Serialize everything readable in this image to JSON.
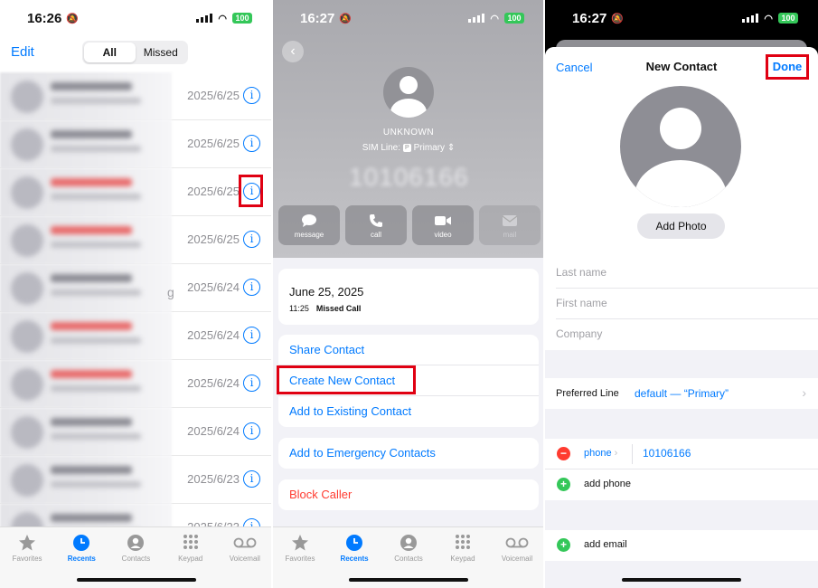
{
  "panel1": {
    "status_time": "16:26",
    "battery": "100",
    "edit_label": "Edit",
    "segment": [
      "All",
      "Missed"
    ],
    "calls": [
      {
        "date": "2025/6/25",
        "name_color": "gray"
      },
      {
        "date": "2025/6/25",
        "name_color": "gray"
      },
      {
        "date": "2025/6/25",
        "name_color": "red"
      },
      {
        "date": "2025/6/25",
        "name_color": "red"
      },
      {
        "date": "2025/6/24",
        "name_color": "gray"
      },
      {
        "date": "2025/6/24",
        "name_color": "red"
      },
      {
        "date": "2025/6/24",
        "name_color": "red"
      },
      {
        "date": "2025/6/24",
        "name_color": "gray"
      },
      {
        "date": "2025/6/23",
        "name_color": "gray"
      },
      {
        "date": "2025/6/23",
        "name_color": "gray"
      }
    ],
    "stray_char": "g",
    "tabs": [
      {
        "label": "Favorites",
        "icon": "star-icon"
      },
      {
        "label": "Recents",
        "icon": "clock-icon"
      },
      {
        "label": "Contacts",
        "icon": "person-icon"
      },
      {
        "label": "Keypad",
        "icon": "keypad-icon"
      },
      {
        "label": "Voicemail",
        "icon": "voicemail-icon"
      }
    ]
  },
  "panel2": {
    "status_time": "16:27",
    "battery": "100",
    "unknown_label": "UNKNOWN",
    "sim_line_label": "SIM Line:",
    "sim_badge": "P",
    "sim_line_value": "Primary",
    "blurred_number": "10106166",
    "actions": [
      {
        "label": "message",
        "icon": "message-icon"
      },
      {
        "label": "call",
        "icon": "phone-icon"
      },
      {
        "label": "video",
        "icon": "video-icon"
      },
      {
        "label": "mail",
        "icon": "mail-icon"
      }
    ],
    "call_date": "June 25, 2025",
    "call_time": "11:25",
    "call_type": "Missed Call",
    "share_contact": "Share Contact",
    "create_new_contact": "Create New Contact",
    "add_to_existing": "Add to Existing Contact",
    "add_to_emergency": "Add to Emergency Contacts",
    "block_caller": "Block Caller"
  },
  "panel3": {
    "status_time": "16:27",
    "battery": "100",
    "cancel": "Cancel",
    "title": "New Contact",
    "done": "Done",
    "add_photo": "Add Photo",
    "last_name_placeholder": "Last name",
    "first_name_placeholder": "First name",
    "company_placeholder": "Company",
    "preferred_line_label": "Preferred Line",
    "preferred_line_value": "default — “Primary”",
    "phone_type": "phone",
    "phone_number": "10106166",
    "add_phone": "add phone",
    "add_email": "add email"
  },
  "colors": {
    "accent": "#007aff",
    "highlight": "#e00012",
    "destructive": "#ff3b30",
    "add_green": "#34c759"
  }
}
